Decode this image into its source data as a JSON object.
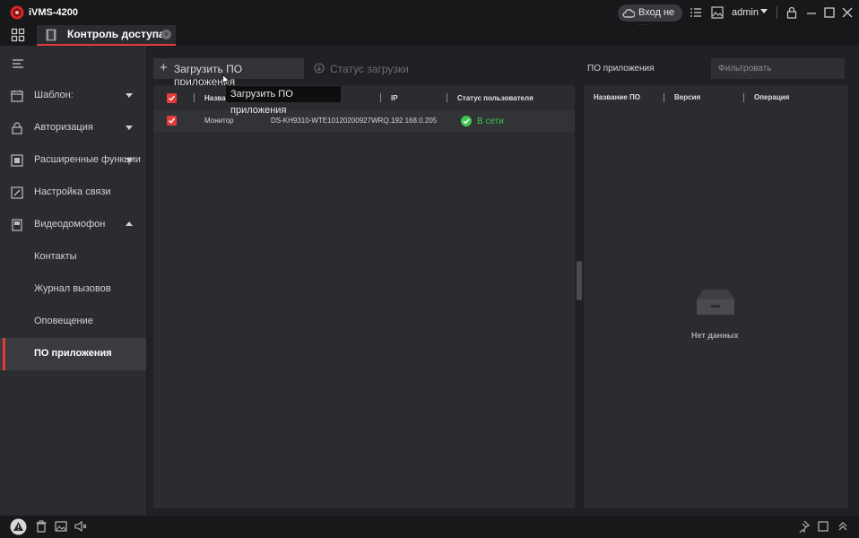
{
  "app": {
    "title": "iVMS-4200",
    "cloud_label": "Вход не ...",
    "user": "admin"
  },
  "tab": {
    "label": "Контроль доступа",
    "close": "×"
  },
  "sidebar": {
    "items": [
      {
        "label": "Шаблон:",
        "icon": "calendar-icon",
        "caret": "down"
      },
      {
        "label": "Авторизация",
        "icon": "lock-icon",
        "caret": "down"
      },
      {
        "label": "Расширенные функции",
        "icon": "advanced-icon",
        "caret": "down"
      },
      {
        "label": "Настройка связи",
        "icon": "link-icon"
      },
      {
        "label": "Видеодомофон",
        "icon": "intercom-icon",
        "caret": "up"
      },
      {
        "label": "Контакты"
      },
      {
        "label": "Журнал вызовов"
      },
      {
        "label": "Оповещение"
      },
      {
        "label": "ПО приложения",
        "active": true
      }
    ]
  },
  "toolbar": {
    "upload_label": "Загрузить ПО приложения",
    "status_label": "Статус загрузки",
    "tooltip": "Загрузить ПО приложения"
  },
  "devices_table": {
    "columns": [
      "Название",
      "IP",
      "Статус пользователя"
    ],
    "rows": [
      {
        "checked": true,
        "name": "Монитор",
        "serial": "DS-KH9310-WTE10120200927WRQ...",
        "ip": "192.168.0.205",
        "status": "В сети"
      }
    ]
  },
  "app_panel": {
    "title": "ПО приложения",
    "filter_placeholder": "Фильтровать",
    "columns": [
      "Название ПО",
      "Версия",
      "Операция"
    ],
    "empty_text": "Нет данных"
  },
  "colors": {
    "accent": "#e23b3b",
    "online": "#3fc54d",
    "panel": "#2b2c30",
    "background": "#202124"
  }
}
